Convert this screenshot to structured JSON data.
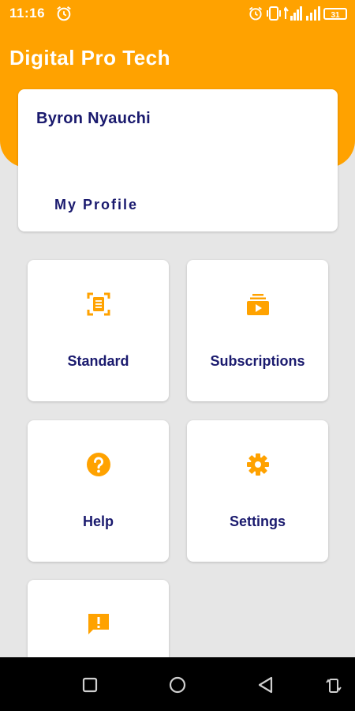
{
  "status_bar": {
    "time": "11:16",
    "battery": "31"
  },
  "app": {
    "title": "Digital Pro Tech"
  },
  "profile": {
    "name": "Byron Nyauchi",
    "link_label": "My Profile"
  },
  "tiles": [
    {
      "label": "Standard",
      "icon": "document-scan-icon"
    },
    {
      "label": "Subscriptions",
      "icon": "subscriptions-icon"
    },
    {
      "label": "Help",
      "icon": "help-icon"
    },
    {
      "label": "Settings",
      "icon": "gear-icon"
    },
    {
      "label": "",
      "icon": "feedback-icon"
    }
  ],
  "nav_bar": {
    "buttons": [
      "square-icon",
      "circle-icon",
      "back-triangle-icon",
      "rotate-icon"
    ]
  },
  "colors": {
    "accent": "#ffa200",
    "text_dark": "#1a1a6e",
    "background": "#e6e6e6"
  }
}
